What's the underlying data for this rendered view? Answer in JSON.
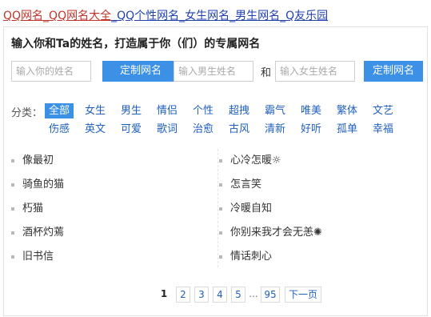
{
  "top_links": [
    {
      "text": "QQ网名",
      "color": "red"
    },
    {
      "text": "_QQ网名大全",
      "color": "red"
    },
    {
      "text": "_QQ个性网名",
      "color": "blue"
    },
    {
      "text": "_女生网名",
      "color": "blue"
    },
    {
      "text": "_男生网名",
      "color": "blue"
    },
    {
      "text": "_Q友乐园",
      "color": "blue"
    }
  ],
  "headline": "输入你和Ta的姓名，打造属于你（们）的专属网名",
  "form": {
    "your_name_placeholder": "输入你的姓名",
    "custom_button_1": "定制网名",
    "male_name_placeholder": "输入男生姓名",
    "and_text": "和",
    "female_name_placeholder": "输入女生姓名",
    "custom_button_2": "定制网名"
  },
  "categories": {
    "label": "分类：",
    "row1": [
      "全部",
      "女生",
      "男生",
      "情侣",
      "个性",
      "超拽",
      "霸气",
      "唯美",
      "繁体",
      "文艺"
    ],
    "row2": [
      "伤感",
      "英文",
      "可爱",
      "歌词",
      "治愈",
      "古风",
      "清新",
      "好听",
      "孤单",
      "幸福"
    ],
    "active": "全部"
  },
  "names_left": [
    "像最初",
    "骑鱼的猫",
    "朽猫",
    "酒杯灼蔫",
    "旧书信"
  ],
  "names_right": [
    "心冷怎暖☼",
    "怎言笑",
    "冷暖自知",
    "你别来我才会无恙✺",
    "情话刺心"
  ],
  "pagination": {
    "current": "1",
    "pages": [
      "2",
      "3",
      "4",
      "5"
    ],
    "ellipsis": "...",
    "last": "95",
    "next": "下一页"
  },
  "colors": {
    "accent": "#3c90e6",
    "link_blue": "#1f5fbf",
    "link_red": "#c0332b"
  }
}
